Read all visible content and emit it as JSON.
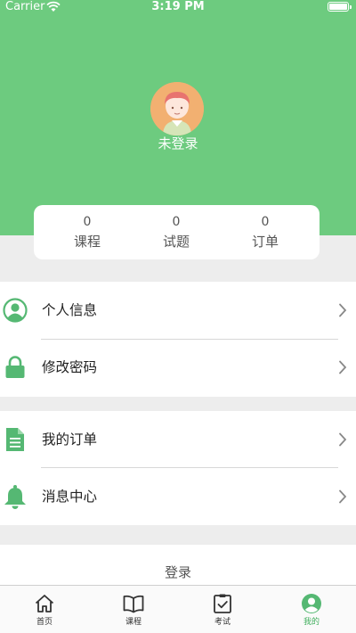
{
  "status_bar": {
    "carrier": "Carrier",
    "time": "3:19 PM"
  },
  "profile": {
    "username": "未登录"
  },
  "stats": [
    {
      "value": "0",
      "label": "课程"
    },
    {
      "value": "0",
      "label": "试题"
    },
    {
      "value": "0",
      "label": "订单"
    }
  ],
  "menu": {
    "personal_info": "个人信息",
    "change_password": "修改密码",
    "my_orders": "我的订单",
    "messages": "消息中心"
  },
  "login_button": "登录",
  "tabs": [
    {
      "label": "首页",
      "icon": "home-icon"
    },
    {
      "label": "课程",
      "icon": "book-icon"
    },
    {
      "label": "考试",
      "icon": "exam-icon"
    },
    {
      "label": "我的",
      "icon": "profile-icon"
    }
  ],
  "colors": {
    "accent": "#6dcb7f",
    "icon_green": "#55b873",
    "background": "#ededed"
  }
}
